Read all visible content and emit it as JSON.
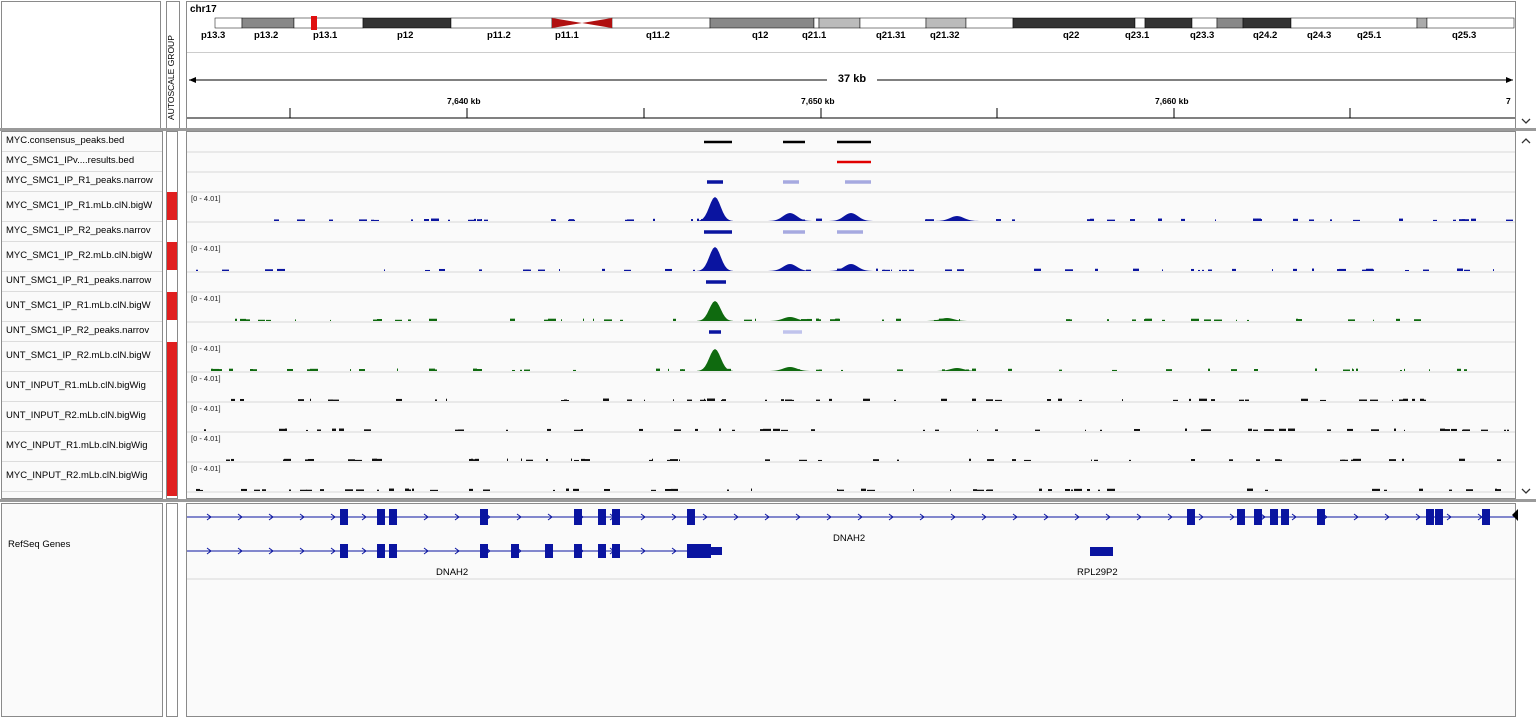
{
  "header": {
    "chromosome": "chr17",
    "autoscale_label": "AUTOSCALE GROUP",
    "span_label": "37 kb",
    "ruler_ticks": [
      "7,640 kb",
      "7,650 kb",
      "7,660 kb",
      "7"
    ],
    "cytobands": [
      "p13.3",
      "p13.2",
      "p13.1",
      "p12",
      "p11.2",
      "p11.1",
      "q11.2",
      "q12",
      "q21.1",
      "q21.31",
      "q21.32",
      "q22",
      "q23.1",
      "q23.3",
      "q24.2",
      "q24.3",
      "q25.1",
      "q25.3"
    ]
  },
  "tracks": [
    {
      "name": "MYC.consensus_peaks.bed",
      "scale": "",
      "type": "bed",
      "color": "#000000"
    },
    {
      "name": "MYC_SMC1_IPv....results.bed",
      "scale": "",
      "type": "bed",
      "color": "#e00000"
    },
    {
      "name": "MYC_SMC1_IP_R1_peaks.narrow",
      "scale": "",
      "type": "bed",
      "color": "#0a14a0"
    },
    {
      "name": "MYC_SMC1_IP_R1.mLb.clN.bigW",
      "scale": "[0 - 4.01]",
      "type": "wig",
      "color": "#0a14a0"
    },
    {
      "name": "MYC_SMC1_IP_R2_peaks.narrov",
      "scale": "",
      "type": "bed",
      "color": "#0a14a0"
    },
    {
      "name": "MYC_SMC1_IP_R2.mLb.clN.bigW",
      "scale": "[0 - 4.01]",
      "type": "wig",
      "color": "#0a14a0"
    },
    {
      "name": "UNT_SMC1_IP_R1_peaks.narrow",
      "scale": "",
      "type": "bed",
      "color": "#0a14a0"
    },
    {
      "name": "UNT_SMC1_IP_R1.mLb.clN.bigW",
      "scale": "[0 - 4.01]",
      "type": "wig",
      "color": "#0f6a0f"
    },
    {
      "name": "UNT_SMC1_IP_R2_peaks.narrov",
      "scale": "",
      "type": "bed",
      "color": "#0a14a0"
    },
    {
      "name": "UNT_SMC1_IP_R2.mLb.clN.bigW",
      "scale": "[0 - 4.01]",
      "type": "wig",
      "color": "#0f6a0f"
    },
    {
      "name": "UNT_INPUT_R1.mLb.clN.bigWig",
      "scale": "[0 - 4.01]",
      "type": "wig",
      "color": "#111111"
    },
    {
      "name": "UNT_INPUT_R2.mLb.clN.bigWig",
      "scale": "[0 - 4.01]",
      "type": "wig",
      "color": "#111111"
    },
    {
      "name": "MYC_INPUT_R1.mLb.clN.bigWig",
      "scale": "[0 - 4.01]",
      "type": "wig",
      "color": "#111111"
    },
    {
      "name": "MYC_INPUT_R2.mLb.clN.bigWig",
      "scale": "[0 - 4.01]",
      "type": "wig",
      "color": "#111111"
    }
  ],
  "genes": {
    "track_name": "RefSeq Genes",
    "labels": [
      "DNAH2",
      "DNAH2",
      "RPL29P2"
    ]
  },
  "colors": {
    "gene": "#0a14a0",
    "selected": "#e02020",
    "peak_light": "#a6a9e0"
  }
}
